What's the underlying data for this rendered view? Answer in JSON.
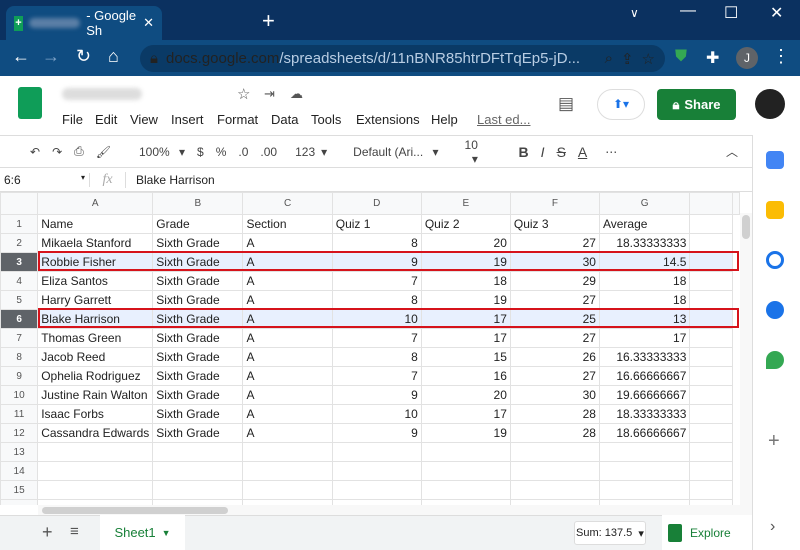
{
  "browser": {
    "tab_title": "- Google Sh",
    "url_host": "docs.google.com",
    "url_path": "/spreadsheets/d/11nBNR85htrDFtTqEp5-jD...",
    "profile_initial": "J"
  },
  "app": {
    "menu": [
      "File",
      "Edit",
      "View",
      "Insert",
      "Format",
      "Data",
      "Tools",
      "Extensions",
      "Help"
    ],
    "last_edit": "Last ed...",
    "share_label": "Share"
  },
  "toolbar": {
    "zoom": "100%",
    "currency": "$",
    "percent": "%",
    "dec_less": ".0",
    "dec_more": ".00",
    "format": "123",
    "font": "Default (Ari...",
    "font_size": "10",
    "bold": "B",
    "italic": "I",
    "strike": "S",
    "text_color": "A",
    "more": "⋯"
  },
  "formula_bar": {
    "cell_ref": "6:6",
    "fx": "fx",
    "value": "Blake Harrison"
  },
  "grid": {
    "columns": [
      "A",
      "B",
      "C",
      "D",
      "E",
      "F",
      "G",
      ""
    ],
    "rows": [
      [
        "Name",
        "Grade",
        "Section",
        "Quiz 1",
        "Quiz 2",
        "Quiz 3",
        "Average"
      ],
      [
        "Mikaela Stanford",
        "Sixth Grade",
        "A",
        "8",
        "20",
        "27",
        "18.33333333"
      ],
      [
        "Robbie Fisher",
        "Sixth Grade",
        "A",
        "9",
        "19",
        "30",
        "14.5"
      ],
      [
        "Eliza Santos",
        "Sixth Grade",
        "A",
        "7",
        "18",
        "29",
        "18"
      ],
      [
        "Harry Garrett",
        "Sixth Grade",
        "A",
        "8",
        "19",
        "27",
        "18"
      ],
      [
        "Blake Harrison",
        "Sixth Grade",
        "A",
        "10",
        "17",
        "25",
        "13"
      ],
      [
        "Thomas Green",
        "Sixth Grade",
        "A",
        "7",
        "17",
        "27",
        "17"
      ],
      [
        "Jacob Reed",
        "Sixth Grade",
        "A",
        "8",
        "15",
        "26",
        "16.33333333"
      ],
      [
        "Ophelia Rodriguez",
        "Sixth Grade",
        "A",
        "7",
        "16",
        "27",
        "16.66666667"
      ],
      [
        "Justine Rain Walton",
        "Sixth Grade",
        "A",
        "9",
        "20",
        "30",
        "19.66666667"
      ],
      [
        "Isaac Forbs",
        "Sixth Grade",
        "A",
        "10",
        "17",
        "28",
        "18.33333333"
      ],
      [
        "Cassandra Edwards",
        "Sixth Grade",
        "A",
        "9",
        "19",
        "28",
        "18.66666667"
      ],
      [
        "",
        "",
        "",
        "",
        "",
        "",
        "",
        ""
      ],
      [
        "",
        "",
        "",
        "",
        "",
        "",
        "",
        ""
      ],
      [
        "",
        "",
        "",
        "",
        "",
        "",
        "",
        ""
      ],
      [
        "",
        "",
        "",
        "",
        "",
        "",
        "",
        ""
      ]
    ],
    "selected_row": 6,
    "highlighted_rows": [
      3,
      6
    ],
    "highlight_color": "#d6131b"
  },
  "bottom": {
    "sheet_name": "Sheet1",
    "sum": "Sum: 137.5",
    "explore": "Explore"
  }
}
